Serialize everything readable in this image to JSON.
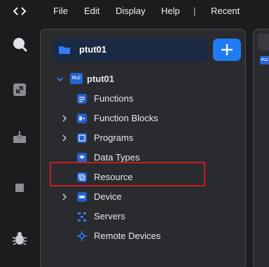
{
  "menubar": {
    "code_icon": "code-brackets-icon",
    "items": [
      "File",
      "Edit",
      "Display",
      "Help"
    ],
    "separator": "|",
    "recent": "Recent"
  },
  "activity_bar": {
    "icons": [
      "search-icon",
      "expand-icon",
      "download-icon",
      "stop-icon",
      "debug-bug-icon"
    ]
  },
  "explorer": {
    "project_name": "ptut01",
    "add_button_icon": "plus-icon",
    "root": {
      "badge": "PLC",
      "label": "ptut01"
    },
    "items": [
      {
        "label": "Functions",
        "icon": "functions-icon",
        "expandable": false
      },
      {
        "label": "Function Blocks",
        "icon": "function-blocks-icon",
        "expandable": true
      },
      {
        "label": "Programs",
        "icon": "programs-icon",
        "expandable": true
      },
      {
        "label": "Data Types",
        "icon": "data-types-icon",
        "expandable": false
      },
      {
        "label": "Resource",
        "icon": "resource-icon",
        "expandable": false,
        "highlighted": true
      },
      {
        "label": "Device",
        "icon": "device-icon",
        "expandable": true
      },
      {
        "label": "Servers",
        "icon": "servers-icon",
        "expandable": false
      },
      {
        "label": "Remote Devices",
        "icon": "remote-devices-icon",
        "expandable": false
      }
    ]
  },
  "editor": {
    "mini_badge": "PLC"
  },
  "colors": {
    "accent": "#1f7cf2",
    "highlight": "#c91d1d",
    "panel": "#2a2b2e",
    "background": "#1b1c1e"
  }
}
